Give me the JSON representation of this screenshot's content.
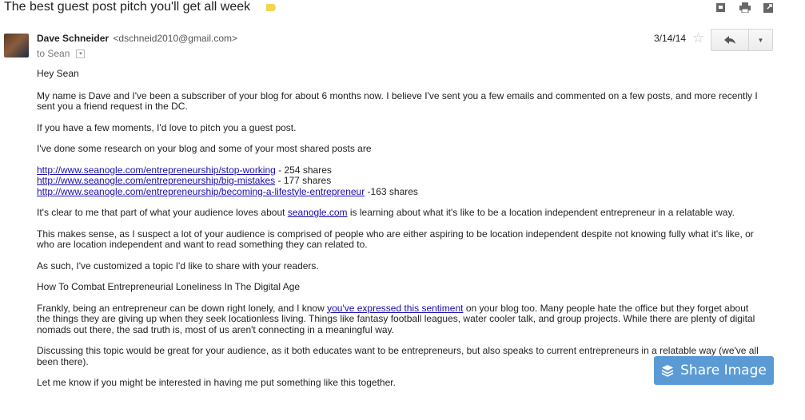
{
  "subject": "The best guest post pitch you'll get all week",
  "colors": {
    "label_tag": "#f3d54e",
    "link": "#1a0dab",
    "share_button": "#5b9bd5"
  },
  "toolbar_icons": [
    "expand-icon",
    "print-icon",
    "new-window-icon"
  ],
  "sender": {
    "name": "Dave Schneider",
    "email": "<dschneid2010@gmail.com>"
  },
  "to": "to Sean",
  "date": "3/14/14",
  "star": "☆",
  "body": {
    "greeting": "Hey Sean",
    "p1": "My name is Dave and I've been a subscriber of your blog for about 6 months now. I believe I've sent you a few emails and commented on a few posts, and more recently I sent you a friend request in the DC.",
    "p2": "If you have a few moments, I'd love to pitch you a guest post.",
    "p3": "I've done some research on your blog and some of your most shared posts are",
    "links": [
      {
        "url": "http://www.seanogle.com/entrepreneurship/stop-working",
        "suffix": " - 254 shares"
      },
      {
        "url": "http://www.seanogle.com/entrepreneurship/big-mistakes",
        "suffix": " - 177 shares"
      },
      {
        "url": "http://www.seanogle.com/entrepreneurship/becoming-a-lifestyle-entrepreneur",
        "suffix": " -163 shares"
      }
    ],
    "p4_pre": "It's clear to me that part of what your audience loves about ",
    "p4_link": "seanogle.com",
    "p4_post": " is learning about what it's like to be a location independent entrepreneur in a relatable way.",
    "p5": "This makes sense, as I suspect a lot of your audience is comprised of people who are either aspiring to be location independent despite not knowing fully what it's like, or who are location independent and want to read something they can related to.",
    "p6": "As such, I've customized a topic I'd like to share with your readers.",
    "p7": "How To Combat Entrepreneurial Loneliness In The Digital Age",
    "p8_pre": "Frankly, being an entrepreneur can be down right lonely, and I know ",
    "p8_link": "you've expressed this sentiment",
    "p8_post": " on your blog too. Many people hate the office but they forget about the things they are giving up when they seek locationless living. Things like fantasy football leagues, water cooler talk, and group projects. While there are plenty of digital nomads out there, the sad truth is, most of us aren't connecting in a meaningful way.",
    "p9": "Discussing this topic would be great for your audience, as it both educates want to be entrepreneurs, but also speaks to current entrepreneurs in a relatable way (we've all been there).",
    "p10": "Let me know if you might be interested in having me put something like this together."
  },
  "share_button": "Share Image"
}
